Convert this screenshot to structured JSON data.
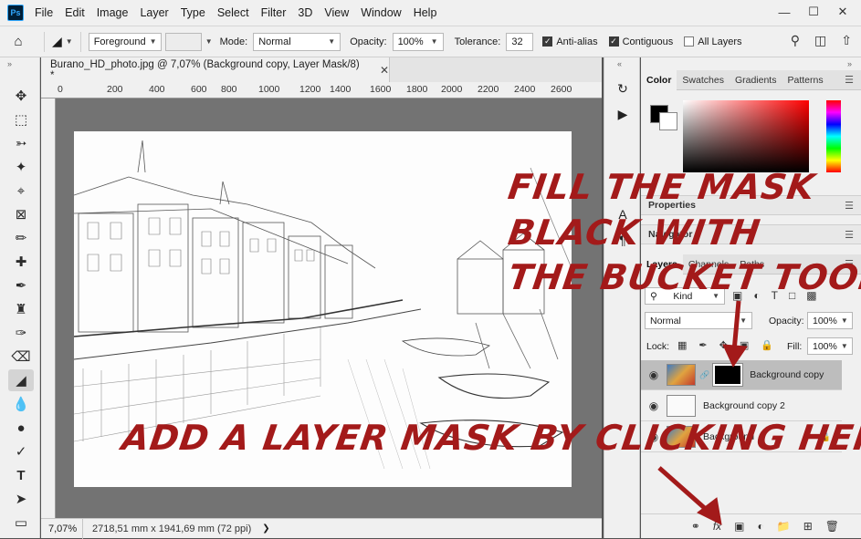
{
  "menubar": {
    "logo": "Ps",
    "items": [
      "File",
      "Edit",
      "Image",
      "Layer",
      "Type",
      "Select",
      "Filter",
      "3D",
      "View",
      "Window",
      "Help"
    ]
  },
  "options": {
    "fill_source": "Foreground",
    "mode_label": "Mode:",
    "mode_value": "Normal",
    "opacity_label": "Opacity:",
    "opacity_value": "100%",
    "tolerance_label": "Tolerance:",
    "tolerance_value": "32",
    "antialias": "Anti-alias",
    "contiguous": "Contiguous",
    "all_layers": "All Layers"
  },
  "document": {
    "tab_title": "Burano_HD_photo.jpg @ 7,07% (Background copy, Layer Mask/8) *",
    "ruler_labels": [
      "0",
      "200",
      "400",
      "600",
      "800",
      "1000",
      "1200",
      "1400",
      "1600",
      "1800",
      "2000",
      "2200",
      "2400",
      "2600"
    ],
    "zoom": "7,07%",
    "size_info": "2718,51 mm x 1941,69 mm (72 ppi)"
  },
  "color_panel": {
    "tabs": [
      "Color",
      "Swatches",
      "Gradients",
      "Patterns"
    ],
    "active": "Color",
    "foreground": "#000000",
    "background": "#ffffff"
  },
  "properties_panel": {
    "title": "Properties"
  },
  "navigator_panel": {
    "title": "Navigator"
  },
  "layers_panel": {
    "tabs": [
      "Layers",
      "Channels",
      "Paths"
    ],
    "kind": "Kind",
    "blend_mode": "Normal",
    "opacity_label": "Opacity:",
    "opacity_value": "100%",
    "lock_label": "Lock:",
    "fill_label": "Fill:",
    "fill_value": "100%",
    "layers": [
      {
        "name": "Background copy",
        "selected": true
      },
      {
        "name": "Background copy 2",
        "selected": false
      },
      {
        "name": "Background",
        "selected": false
      }
    ]
  },
  "annotations": {
    "line1": "FILL THE MASK",
    "line2": "BLACK WITH",
    "line3": "THE BUCKET TOOL",
    "line4": "ADD A LAYER MASK BY CLICKING HERE",
    "color": "#a31a1a"
  }
}
